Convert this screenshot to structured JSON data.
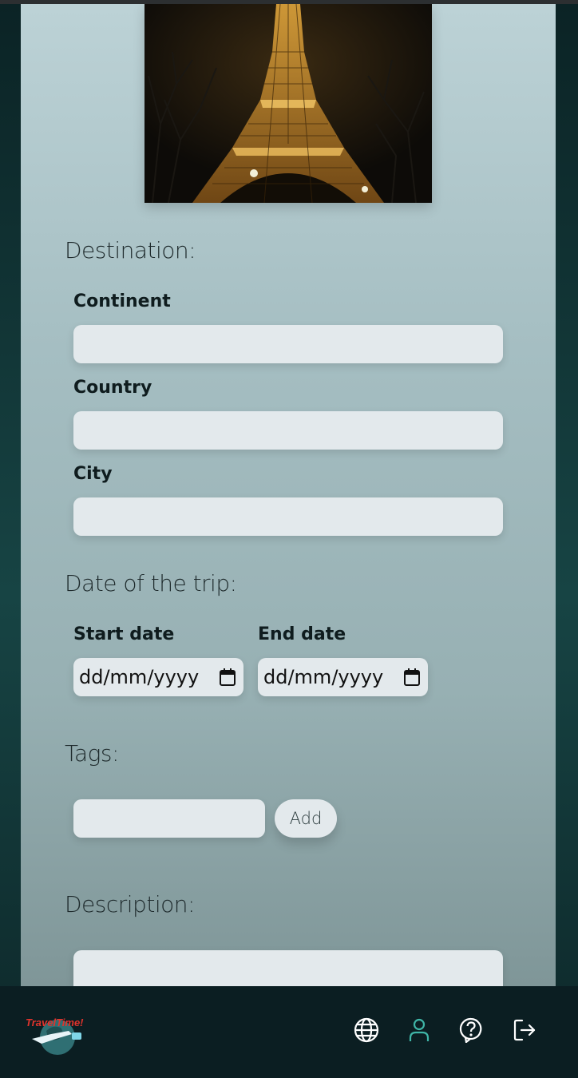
{
  "form": {
    "destination_title": "Destination:",
    "continent_label": "Continent",
    "country_label": "Country",
    "city_label": "City",
    "date_title": "Date of the trip:",
    "start_date_label": "Start date",
    "end_date_label": "End date",
    "start_date_placeholder": "dd/mm/yyyy",
    "end_date_placeholder": "dd/mm/yyyy",
    "tags_title": "Tags:",
    "add_button_label": "Add",
    "description_title": "Description:"
  },
  "logo": {
    "text": "TravelTime!"
  },
  "nav": {
    "items": [
      {
        "icon": "globe-icon",
        "color": "#ffffff"
      },
      {
        "icon": "user-icon",
        "color": "#3fb5a7"
      },
      {
        "icon": "help-icon",
        "color": "#ffffff"
      },
      {
        "icon": "logout-icon",
        "color": "#ffffff"
      }
    ]
  },
  "colors": {
    "panel_top": "#bcd2d6",
    "field_bg": "#e3e9ec",
    "bottom_bar": "#0b1e22",
    "accent": "#3fb5a7"
  }
}
